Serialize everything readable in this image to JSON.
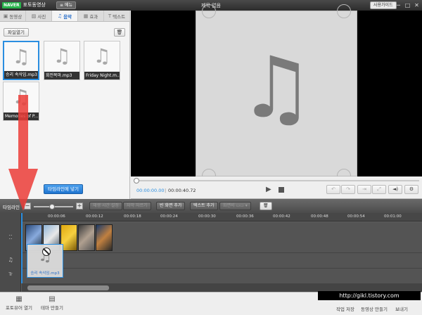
{
  "titlebar": {
    "brand": "NAVER",
    "app_name": "포토동영상",
    "menu_label": "≡ 메뉴",
    "window_title": "제목 없음",
    "guide_label": "사용가이드",
    "minimize": "─",
    "maximize": "□",
    "close": "✕"
  },
  "media_tabs": [
    {
      "label": "동영상",
      "icon": "film-icon"
    },
    {
      "label": "사진",
      "icon": "photo-icon"
    },
    {
      "label": "음악",
      "icon": "music-icon",
      "active": true
    },
    {
      "label": "효과",
      "icon": "effect-icon"
    },
    {
      "label": "텍스트",
      "icon": "text-icon"
    }
  ],
  "library": {
    "open_file_label": "파일열기",
    "trash_icon": "🗑",
    "items": [
      {
        "caption": "승리 속삭임.mp3",
        "selected": true
      },
      {
        "caption": "회전목마.mp3",
        "selected": false
      },
      {
        "caption": "Friday Night.m...",
        "selected": false
      },
      {
        "caption": "Memories of P...",
        "selected": false
      }
    ],
    "add_to_timeline_label": "타임라인에 넣기"
  },
  "player": {
    "current_time": "00:00:00.00",
    "separator": "|",
    "total_time": "00:00:40.72",
    "play_icon": "▶",
    "undo_icon": "↶",
    "redo_icon": "↷",
    "fit_icon": "⇥",
    "crop_icon": "⤢",
    "volume_icon": "◄)",
    "settings_icon": "⚙"
  },
  "timeline_toolbar": {
    "label": "타임라인",
    "zoom_minus": "−",
    "zoom_plus": "+",
    "buttons": [
      {
        "label": "재생 시간 설정",
        "disabled": true
      },
      {
        "label": "자막 자르기",
        "disabled": true
      },
      {
        "label": "빈 화면 추가",
        "disabled": false
      },
      {
        "label": "텍스트 추가",
        "disabled": false
      },
      {
        "label": "화면비 ▭▭ ▾",
        "disabled": true
      }
    ],
    "trash_icon": "🗑"
  },
  "timeline": {
    "ticks": [
      "00:00:06",
      "00:00:12",
      "00:00:18",
      "00:00:24",
      "00:00:30",
      "00:00:36",
      "00:00:42",
      "00:00:48",
      "00:00:54",
      "00:01:00"
    ],
    "track_icons": [
      "⁚⁚",
      "♫",
      "Tr"
    ],
    "dragged_item_caption": "승리 속삭임.mp3"
  },
  "bottombar": {
    "left_buttons": [
      {
        "label": "포토뷰어 열기",
        "icon": "photo-viewer-icon",
        "glyph": "▦"
      },
      {
        "label": "테마 만들기",
        "icon": "theme-icon",
        "glyph": "▤"
      }
    ],
    "right_buttons": [
      "작업 저장",
      "동영상 만들기",
      "보내기"
    ]
  },
  "watermark": "http://gikl.tistory.com"
}
